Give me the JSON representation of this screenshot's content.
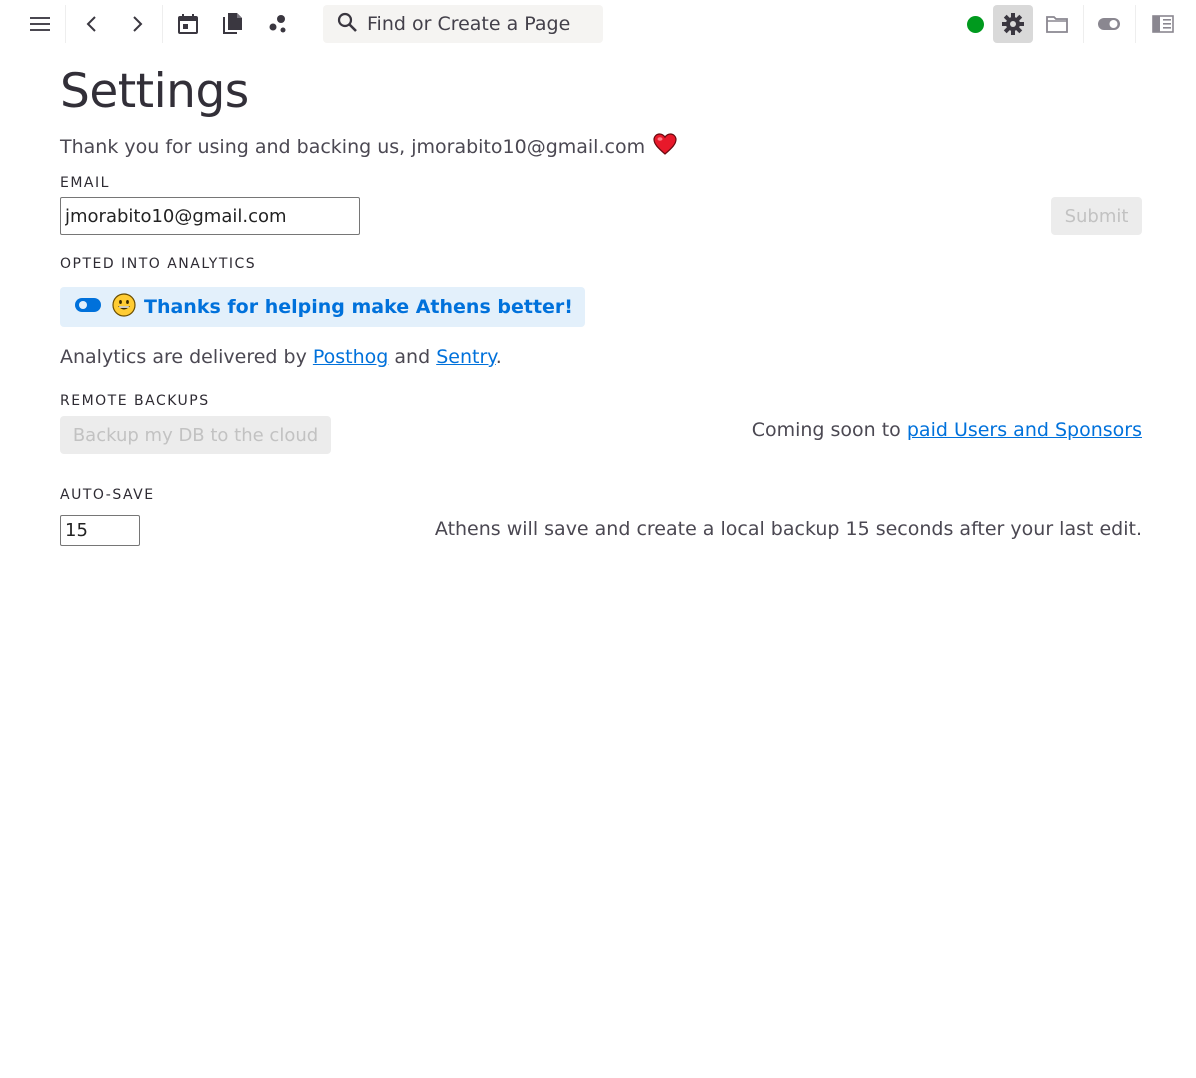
{
  "toolbar": {
    "search_placeholder": "Find or Create a Page",
    "status_color": "#009a1e",
    "icons": [
      "menu-icon",
      "back-icon",
      "forward-icon",
      "calendar-icon",
      "all-pages-icon",
      "graph-icon",
      "search-icon",
      "settings-icon",
      "folder-icon",
      "toggle-icon",
      "right-sidebar-icon"
    ]
  },
  "page": {
    "title": "Settings",
    "thanks_text": "Thank you for using and backing us, jmorabito10@gmail.com",
    "thanks_emoji": "heart-icon"
  },
  "email": {
    "label": "EMAIL",
    "value": "jmorabito10@gmail.com",
    "submit_label": "Submit"
  },
  "analytics": {
    "label": "OPTED INTO ANALYTICS",
    "toggle_text": "Thanks for helping make Athens better!",
    "enabled": true,
    "delivered_prefix": "Analytics are delivered by",
    "link_posthog": "Posthog",
    "and_text": "and",
    "link_sentry": "Sentry",
    "period": "."
  },
  "backups": {
    "label": "REMOTE BACKUPS",
    "button_label": "Backup my DB to the cloud",
    "coming_soon_prefix": "Coming soon to",
    "coming_soon_link": "paid Users and Sponsors"
  },
  "autosave": {
    "label": "AUTO-SAVE",
    "value": "15",
    "help_text": "Athens will save and create a local backup 15 seconds after your last edit."
  },
  "colors": {
    "accent": "#0071db",
    "accent_bg": "#e3f0fb",
    "text": "#322f38",
    "disabled_bg": "#ececec",
    "disabled_text": "#c2c2c2"
  }
}
